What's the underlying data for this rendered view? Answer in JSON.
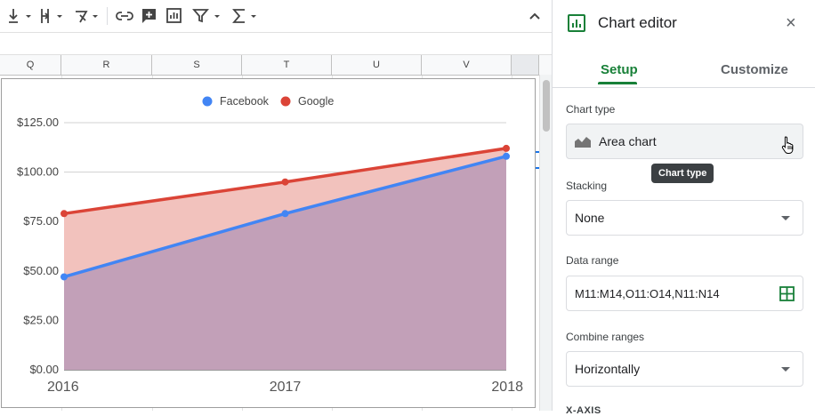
{
  "toolbar": {
    "icons": [
      "insert-down-icon",
      "align-vertical-icon",
      "text-rotation-icon",
      "link-icon",
      "comment-icon",
      "insert-chart-icon",
      "filter-icon",
      "sum-icon",
      "collapse-icon"
    ]
  },
  "columns": [
    "Q",
    "R",
    "S",
    "T",
    "U",
    "V"
  ],
  "chart_data": {
    "type": "area",
    "categories": [
      "2016",
      "2017",
      "2018"
    ],
    "series": [
      {
        "name": "Facebook",
        "values": [
          47,
          79,
          108
        ],
        "color": "#4285f4",
        "fill": "#c2a0b8"
      },
      {
        "name": "Google",
        "values": [
          79,
          95,
          112
        ],
        "color": "#db4437",
        "fill": "#f2c2bd"
      }
    ],
    "yticks": [
      "$0.00",
      "$25.00",
      "$50.00",
      "$75.00",
      "$100.00",
      "$125.00"
    ],
    "ytick_values": [
      0,
      25,
      50,
      75,
      100,
      125
    ],
    "ylim": [
      0,
      125
    ],
    "legend_position": "top",
    "grid": true,
    "stacking": "none"
  },
  "panel": {
    "title": "Chart editor",
    "close": "×",
    "tabs": {
      "setup": "Setup",
      "customize": "Customize"
    },
    "chart_type": {
      "label": "Chart type",
      "value": "Area chart",
      "tooltip": "Chart type"
    },
    "stacking": {
      "label": "Stacking",
      "value": "None"
    },
    "data_range": {
      "label": "Data range",
      "value": "M11:M14,O11:O14,N11:N14"
    },
    "combine": {
      "label": "Combine ranges",
      "value": "Horizontally"
    },
    "next_section": "X-AXIS"
  }
}
